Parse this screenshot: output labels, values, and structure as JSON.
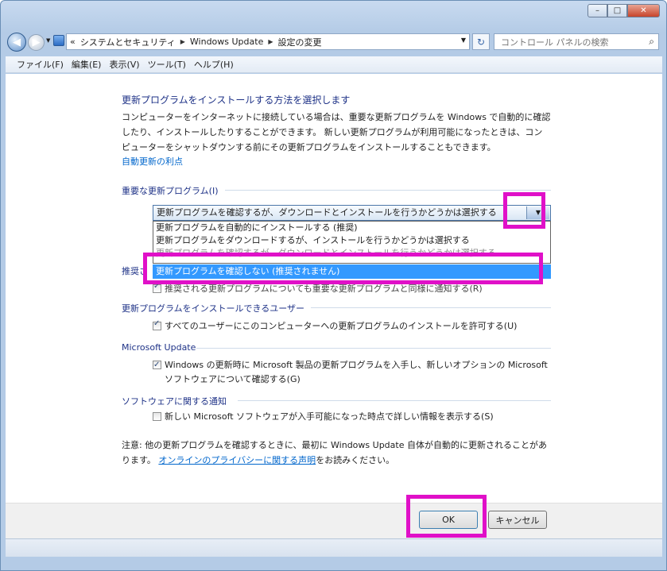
{
  "window": {
    "minimize": "–",
    "maximize": "□",
    "close": "✕"
  },
  "nav": {
    "back": "◀",
    "forward": "▶",
    "recent": "▼",
    "chevrons": "«",
    "breadcrumbs": [
      "システムとセキュリティ",
      "Windows Update",
      "設定の変更"
    ],
    "refresh": "↻",
    "search_placeholder": "コントロール パネルの検索"
  },
  "menu": [
    "ファイル(F)",
    "編集(E)",
    "表示(V)",
    "ツール(T)",
    "ヘルプ(H)"
  ],
  "main": {
    "heading": "更新プログラムをインストールする方法を選択します",
    "description": "コンピューターをインターネットに接続している場合は、重要な更新プログラムを Windows で自動的に確認したり、インストールしたりすることができます。 新しい更新プログラムが利用可能になったときは、コンピューターをシャットダウンする前にその更新プログラムをインストールすることもできます。",
    "benefit_link": "自動更新の利点",
    "important": {
      "title": "重要な更新プログラム(I)",
      "selected": "更新プログラムを確認するが、ダウンロードとインストールを行うかどうかは選択する",
      "options": [
        "更新プログラムを自動的にインストールする (推奨)",
        "更新プログラムをダウンロードするが、インストールを行うかどうかは選択する",
        "更新プログラムを確認するが、ダウンロードとインストールを行うかどうかは選択する"
      ],
      "highlighted_option": "更新プログラムを確認しない (推奨されません)"
    },
    "recommended": {
      "title": "推奨さ",
      "checkbox_label": "推奨される更新プログラムについても重要な更新プログラムと同様に通知する(R)"
    },
    "users": {
      "title": "更新プログラムをインストールできるユーザー",
      "checkbox_label": "すべてのユーザーにこのコンピューターへの更新プログラムのインストールを許可する(U)"
    },
    "microsoft_update": {
      "title": "Microsoft Update",
      "checkbox_label": "Windows の更新時に Microsoft 製品の更新プログラムを入手し、新しいオプションの Microsoft ソフトウェアについて確認する(G)"
    },
    "software": {
      "title": "ソフトウェアに関する通知",
      "checkbox_label": "新しい Microsoft ソフトウェアが入手可能になった時点で詳しい情報を表示する(S)"
    },
    "note_prefix": "注意: 他の更新プログラムを確認するときに、最初に Windows Update 自体が自動的に更新されることがあります。",
    "note_link": "オンラインのプライバシーに関する声明",
    "note_suffix": "をお読みください。"
  },
  "footer": {
    "ok": "OK",
    "cancel": "キャンセル"
  },
  "highlight_color": "#e010c8"
}
